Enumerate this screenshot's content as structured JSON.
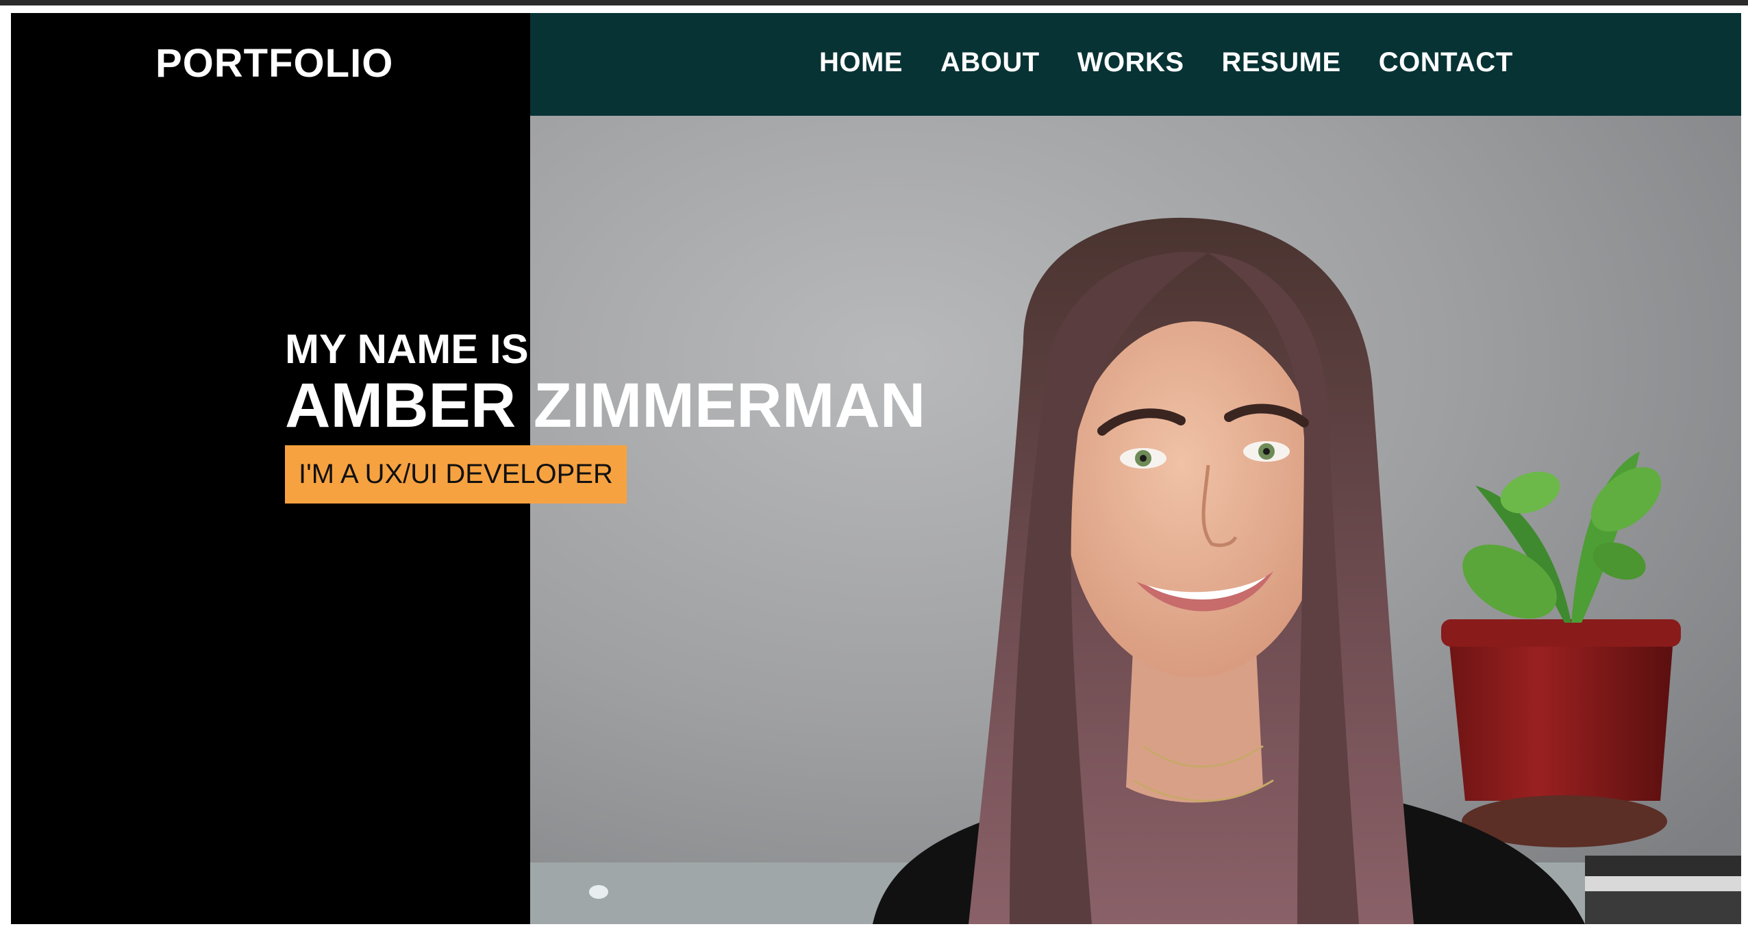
{
  "brand": "PORTFOLIO",
  "nav": {
    "items": [
      {
        "label": "HOME"
      },
      {
        "label": "ABOUT"
      },
      {
        "label": "WORKS"
      },
      {
        "label": "RESUME"
      },
      {
        "label": "CONTACT"
      }
    ]
  },
  "hero": {
    "intro": "MY NAME IS",
    "name": "AMBER ZIMMERMAN",
    "role": "I'M A UX/UI DEVELOPER"
  },
  "colors": {
    "navbar": "#083335",
    "left_panel": "#000000",
    "accent": "#f7a240"
  }
}
